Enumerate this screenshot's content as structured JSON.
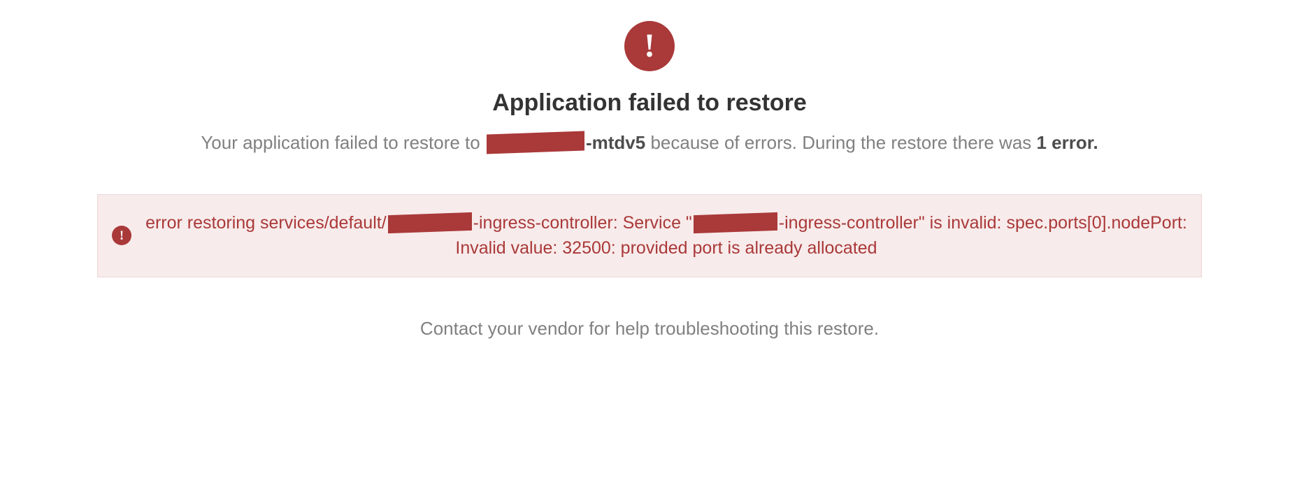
{
  "hero": {
    "icon_name": "exclamation-icon"
  },
  "title": "Application failed to restore",
  "subtitle": {
    "prefix": "Your application failed to restore to ",
    "redacted_suffix": "-mtdv5",
    "middle": " because of errors. During the restore there was ",
    "error_count_text": "1 error."
  },
  "error": {
    "icon_name": "exclamation-icon",
    "msg_part1": "error restoring services/default/",
    "msg_part2": "-ingress-controller: Service \"",
    "msg_part3": "-ingress-controller\" is invalid: spec.ports[0].nodePort: Invalid value: 32500: provided port is already allocated"
  },
  "footer": "Contact your vendor for help troubleshooting this restore."
}
